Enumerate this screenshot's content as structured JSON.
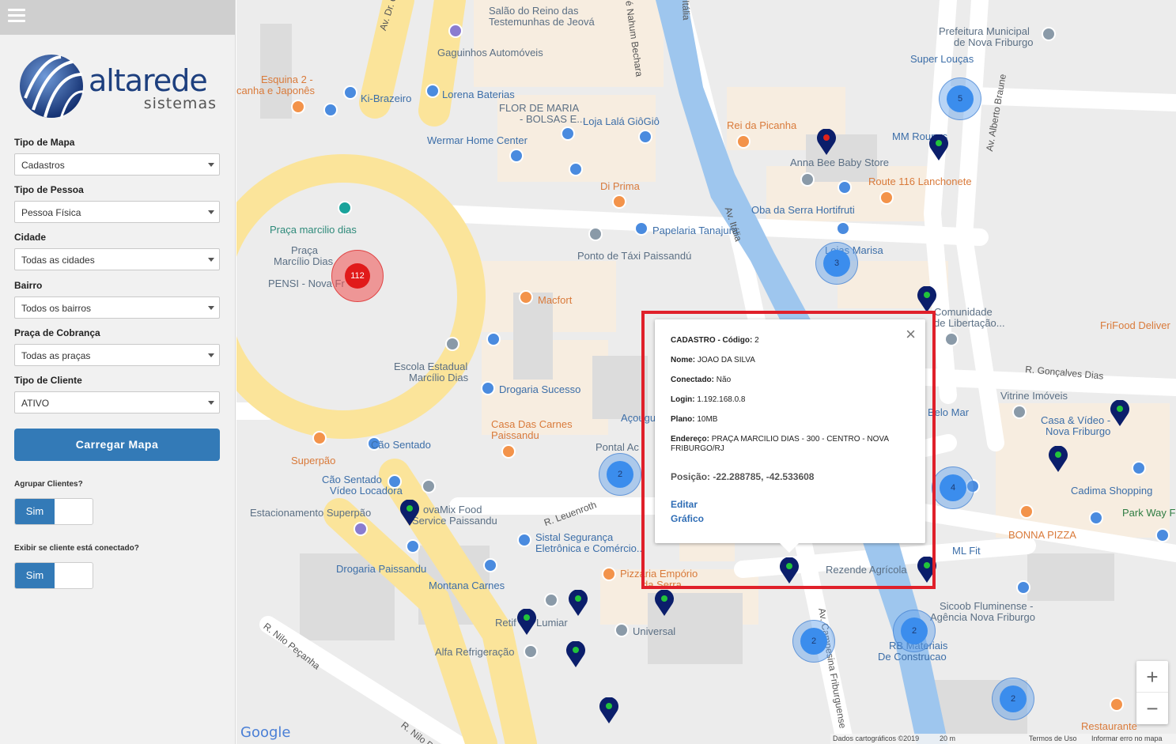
{
  "sidebar": {
    "logo": {
      "name": "altarede",
      "sub": "sistemas"
    },
    "fields": [
      {
        "label": "Tipo de Mapa",
        "value": "Cadastros"
      },
      {
        "label": "Tipo de Pessoa",
        "value": "Pessoa Física"
      },
      {
        "label": "Cidade",
        "value": "Todas as cidades"
      },
      {
        "label": "Bairro",
        "value": "Todos os bairros"
      },
      {
        "label": "Praça de Cobrança",
        "value": "Todas as praças"
      },
      {
        "label": "Tipo de Cliente",
        "value": "ATIVO"
      }
    ],
    "load_button": "Carregar Mapa",
    "toggles": [
      {
        "label": "Agrupar Clientes?",
        "value": "Sim"
      },
      {
        "label": "Exibir se cliente está conectado?",
        "value": "Sim"
      }
    ]
  },
  "map": {
    "labels": {
      "l1": "Salão do Reino das",
      "l2": "Testemunhas de Jeová",
      "l3": "Gaguinhos Automóveis",
      "l4": "Esquina 2 -",
      "l5": "canha e Japonês",
      "l6": "Ki-Brazeiro",
      "l7": "Lorena Baterias",
      "l8": "FLOR DE MARIA",
      "l9": "- BOLSAS E...",
      "l10": "Loja Lalá GiôGiô",
      "l11": "Wermar Home Center",
      "l12": "Di Prima",
      "l13": "Papelaria Tanajura",
      "l14": "Ponto de Táxi Paissandú",
      "l15": "Praça marcilio dias",
      "l16": "Praça",
      "l17": "Marcílio Dias",
      "l18": "PENSI - Nova Fr",
      "l19": "Macfort",
      "l20": "Escola Estadual",
      "l21": "Marcílio Dias",
      "l22": "Drogaria Sucesso",
      "l23": "Casa Das Carnes",
      "l24": "Paissandu",
      "l25": "Cão Sentado",
      "l26": "Superpão",
      "l27": "Cão Sentado",
      "l28": "Vídeo Locadora",
      "l29": "Estacionamento Superpão",
      "l30": "ovaMix Food",
      "l31": "Service Paissandu",
      "l32": "Drogaria Paissandu",
      "l33": "Montana Carnes",
      "l34": "Sistal Segurança",
      "l35": "Eletrônica e Comércio...",
      "l36": "Pizzaria Empório",
      "l37": "da Serra",
      "l38": "Retif",
      "l39": "Lumiar",
      "l40": "Alfa Refrigeração",
      "l41": "Universal",
      "l42": "Pontal Ac",
      "l43": "Açougue",
      "l44": "Prefeitura Municipal",
      "l45": "de Nova Friburgo",
      "l46": "Super Louças",
      "l47": "Rei da Picanha",
      "l48": "MM Roupas",
      "l49": "Anna Bee Baby Store",
      "l50": "Route 116 Lanchonete",
      "l51": "Oba da Serra Hortifruti",
      "l52": "Lojas Marisa",
      "l53": "Comunidade",
      "l54": "de Libertação...",
      "l55": "FriFood Deliver",
      "l56": "Vitrine Imóveis",
      "l57": "Casa & Vídeo -",
      "l58": "Nova Friburgo",
      "l59": "Cadima Shopping",
      "l60": "Park Way F",
      "l61": "BONNA PIZZA",
      "l62": "ML Fit",
      "l63": "Rezende Agrícola",
      "l64": "Sicoob Fluminense -",
      "l65": "Agência Nova Friburgo",
      "l66": "RB Materiais",
      "l67": "De Construcao",
      "l68": "Restaurante",
      "l69": "Belo Mar"
    },
    "roads": {
      "r1": "Av. Dr. Galo",
      "r2": "Av. Itália",
      "r3": "Av. Alberto Braune",
      "r4": "R. Gonçalves Dias",
      "r5": "R. Leuenroth",
      "r6": "R. Nilo Peçanha",
      "r7": "Av. Campesina Friburguense",
      "r8": "Itália",
      "r9": "é Nahum Bechara",
      "r10": "R. Nilo P"
    },
    "clusters": [
      {
        "count": "112",
        "color": "red"
      },
      {
        "count": "5",
        "color": "blue"
      },
      {
        "count": "3",
        "color": "blue"
      },
      {
        "count": "2",
        "color": "blue"
      },
      {
        "count": "4",
        "color": "blue"
      },
      {
        "count": "2",
        "color": "blue"
      },
      {
        "count": "2",
        "color": "blue"
      },
      {
        "count": "2",
        "color": "blue"
      }
    ],
    "footer": {
      "data": "Dados cartográficos ©2019",
      "scale": "20 m",
      "terms": "Termos de Uso",
      "report": "Informar erro no mapa"
    },
    "zoom": {
      "in": "+",
      "out": "−"
    },
    "google": "Google"
  },
  "popup": {
    "codigo_label": "CADASTRO - Código:",
    "codigo": "2",
    "nome_label": "Nome:",
    "nome": "JOAO DA SILVA",
    "conectado_label": "Conectado:",
    "conectado": "Não",
    "login_label": "Login:",
    "login": "1.192.168.0.8",
    "plano_label": "Plano:",
    "plano": "10MB",
    "endereco_label": "Endereço:",
    "endereco": "PRAÇA MARCILIO DIAS - 300 - CENTRO - NOVA FRIBURGO/RJ",
    "posicao_label": "Posição:",
    "posicao": "-22.288785, -42.533608",
    "editar": "Editar",
    "grafico": "Gráfico",
    "close": "×"
  }
}
